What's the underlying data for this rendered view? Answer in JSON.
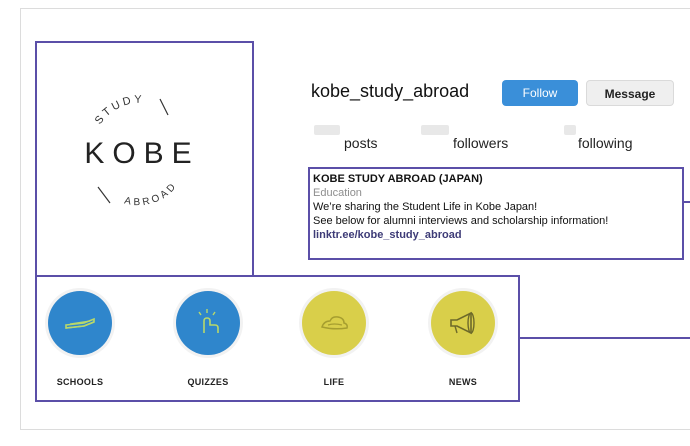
{
  "profile": {
    "username": "kobe_study_abroad",
    "follow_label": "Follow",
    "message_label": "Message"
  },
  "stats": {
    "posts_label": "posts",
    "followers_label": "followers",
    "following_label": "following"
  },
  "bio": {
    "name": "KOBE STUDY ABROAD (JAPAN)",
    "category": "Education",
    "line1": "We’re sharing the Student Life in Kobe Japan!",
    "line2": "See below for alumni interviews and scholarship information!",
    "link": "linktr.ee/kobe_study_abroad"
  },
  "logo": {
    "main": "KOBE",
    "top": "STUDY",
    "bottom": "ABROAD"
  },
  "highlights": [
    {
      "label": "SCHOOLS",
      "color": "#2f86cc",
      "icon": "school-icon"
    },
    {
      "label": "QUIZZES",
      "color": "#2f86cc",
      "icon": "quiz-icon"
    },
    {
      "label": "LIFE",
      "color": "#d9cf4a",
      "icon": "life-icon"
    },
    {
      "label": "NEWS",
      "color": "#d9cf4a",
      "icon": "megaphone-icon"
    }
  ],
  "colors": {
    "frame": "#5b4fa8",
    "follow_button": "#3a8fd9",
    "link": "#3d3b77"
  }
}
